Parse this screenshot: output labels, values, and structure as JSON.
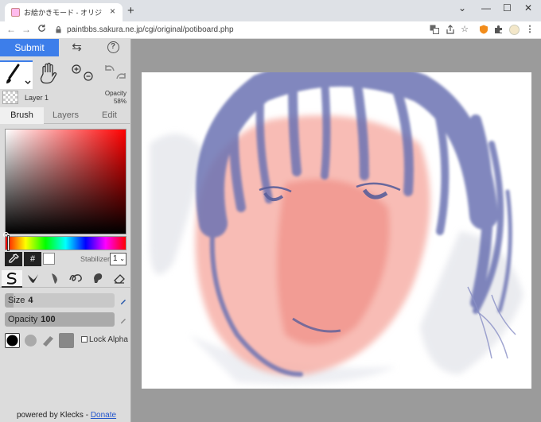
{
  "browser": {
    "tab_title": "お絵かきモード - オリジナルお絵かき掲",
    "tab_close_glyph": "×",
    "new_tab_glyph": "+",
    "url": "paintbbs.sakura.ne.jp/cgi/original/potiboard.php",
    "window_controls": [
      "⌄",
      "—",
      "☐",
      "✕"
    ],
    "nav": {
      "back": "←",
      "forward": "→",
      "reload": "C"
    },
    "toolbar_icons": [
      "translate-icon",
      "share-icon",
      "bookmark-star-icon",
      "extension-orange-icon",
      "extensions-puzzle-icon",
      "profile-icon",
      "menu-icon"
    ],
    "menu_glyph": "⋮",
    "star_glyph": "☆"
  },
  "app": {
    "submit_label": "Submit",
    "swap_glyph": "⇆",
    "help_glyph": "?",
    "layer": {
      "name": "Layer 1",
      "opacity_label": "Opacity",
      "opacity_value": "58%"
    },
    "tabs": [
      {
        "label": "Brush",
        "active": true
      },
      {
        "label": "Layers",
        "active": false
      },
      {
        "label": "Edit",
        "active": false
      }
    ],
    "hex_label": "#",
    "stabilizer_label": "Stabilizer",
    "stabilizer_value": "1",
    "size": {
      "label": "Size",
      "value": "4",
      "fraction": 0.08
    },
    "opacity": {
      "label": "Opacity",
      "value": "100",
      "fraction": 1.0
    },
    "lock_alpha_label": "Lock Alpha",
    "footer_prefix": "powered by Klecks - ",
    "donate_label": "Donate",
    "colors": {
      "accent": "#3d7eea",
      "panel": "#dcdcdc",
      "workspace": "#9b9b9b",
      "primary_color": "#000000",
      "secondary_color": "#ffffff"
    }
  }
}
